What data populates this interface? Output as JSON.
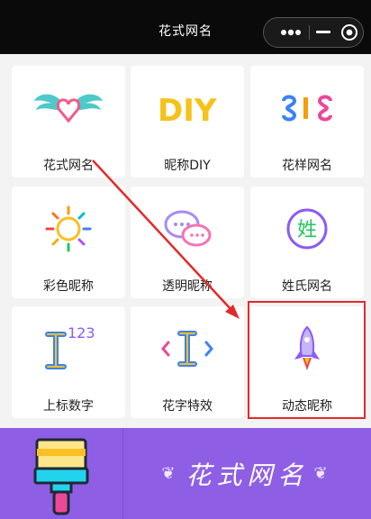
{
  "header": {
    "title": "花式网名"
  },
  "tiles": [
    {
      "label": "花式网名",
      "icon": "winged-heart-icon"
    },
    {
      "label": "昵称DIY",
      "icon": "diy-letters-icon"
    },
    {
      "label": "花样网名",
      "icon": "colorful-symbol-icon"
    },
    {
      "label": "彩色昵称",
      "icon": "sun-icon"
    },
    {
      "label": "透明昵称",
      "icon": "chat-bubbles-icon"
    },
    {
      "label": "姓氏网名",
      "icon": "surname-badge-icon"
    },
    {
      "label": "上标数字",
      "icon": "superscript-icon",
      "superscript": "123"
    },
    {
      "label": "花字特效",
      "icon": "text-cursor-icon"
    },
    {
      "label": "动态昵称",
      "icon": "rocket-icon"
    }
  ],
  "tile_icon_chars": {
    "diy": "DIY",
    "surname": "姓"
  },
  "banner": {
    "slogan": "花式网名",
    "flourish": "❦"
  },
  "colors": {
    "accent_purple": "#8e5fe5",
    "annotation_red": "#e12b2b"
  }
}
